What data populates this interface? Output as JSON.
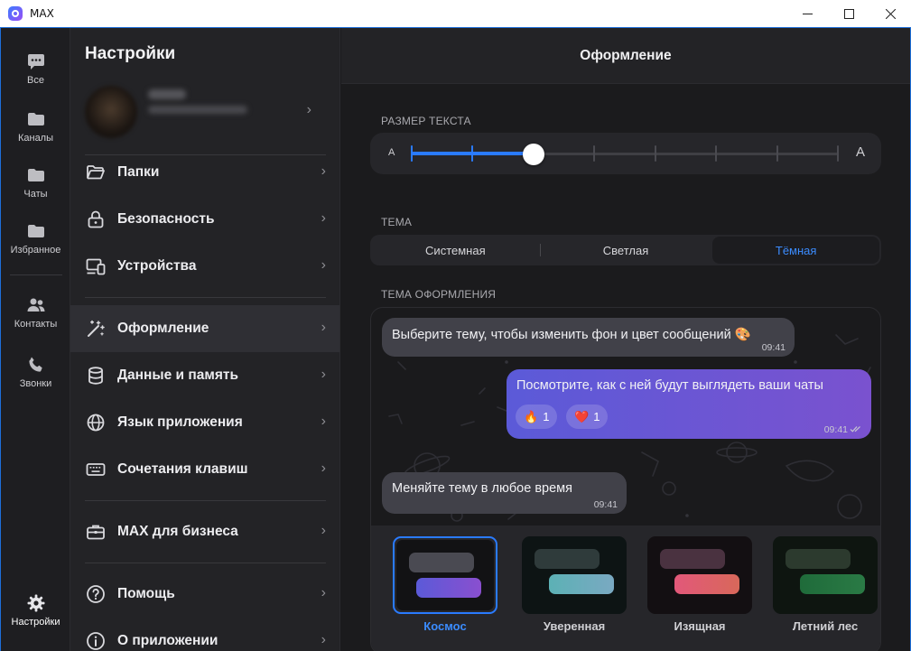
{
  "window": {
    "title": "MAX"
  },
  "rail": {
    "items": [
      {
        "label": "Все",
        "icon": "chat-bubble-icon"
      },
      {
        "label": "Каналы",
        "icon": "folder-icon"
      },
      {
        "label": "Чаты",
        "icon": "folder-icon"
      },
      {
        "label": "Избранное",
        "icon": "folder-icon"
      },
      {
        "label": "Контакты",
        "icon": "contacts-icon"
      },
      {
        "label": "Звонки",
        "icon": "phone-icon"
      },
      {
        "label": "Настройки",
        "icon": "gear-icon"
      }
    ]
  },
  "settings": {
    "title": "Настройки",
    "menu": [
      {
        "label": "Папки",
        "icon": "folder-open-icon"
      },
      {
        "label": "Безопасность",
        "icon": "lock-icon"
      },
      {
        "label": "Устройства",
        "icon": "devices-icon"
      },
      {
        "label": "Оформление",
        "icon": "magic-wand-icon",
        "active": true
      },
      {
        "label": "Данные и память",
        "icon": "database-icon"
      },
      {
        "label": "Язык приложения",
        "icon": "globe-icon"
      },
      {
        "label": "Сочетания клавиш",
        "icon": "keyboard-icon"
      },
      {
        "label": "MAX для бизнеса",
        "icon": "briefcase-icon"
      },
      {
        "label": "Помощь",
        "icon": "help-icon"
      },
      {
        "label": "О приложении",
        "icon": "info-icon"
      }
    ]
  },
  "main": {
    "title": "Оформление",
    "text_size": {
      "label": "РАЗМЕР ТЕКСТА",
      "small": "A",
      "large": "A",
      "steps": 8,
      "selected_step": 3
    },
    "theme": {
      "label": "ТЕМА",
      "options": [
        "Системная",
        "Светлая",
        "Тёмная"
      ],
      "selected": "Тёмная"
    },
    "appearance": {
      "label": "ТЕМА ОФОРМЛЕНИЯ",
      "messages": [
        {
          "text": "Выберите тему, чтобы изменить фон и цвет сообщений 🎨",
          "time": "09:41",
          "dir": "in"
        },
        {
          "text": "Посмотрите, как с ней будут выглядеть ваши чаты",
          "time": "09:41",
          "dir": "out",
          "reactions": [
            {
              "emoji": "🔥",
              "count": "1"
            },
            {
              "emoji": "❤️",
              "count": "1"
            }
          ]
        },
        {
          "text": "Меняйте тему в любое время",
          "time": "09:41",
          "dir": "in"
        }
      ],
      "themes": [
        {
          "name": "Космос",
          "selected": true
        },
        {
          "name": "Уверенная"
        },
        {
          "name": "Изящная"
        },
        {
          "name": "Летний лес"
        }
      ]
    }
  },
  "colors": {
    "accent": "#2a7bff",
    "window_border": "#1e6fd9",
    "active_theme_label": "#3b8cff"
  }
}
